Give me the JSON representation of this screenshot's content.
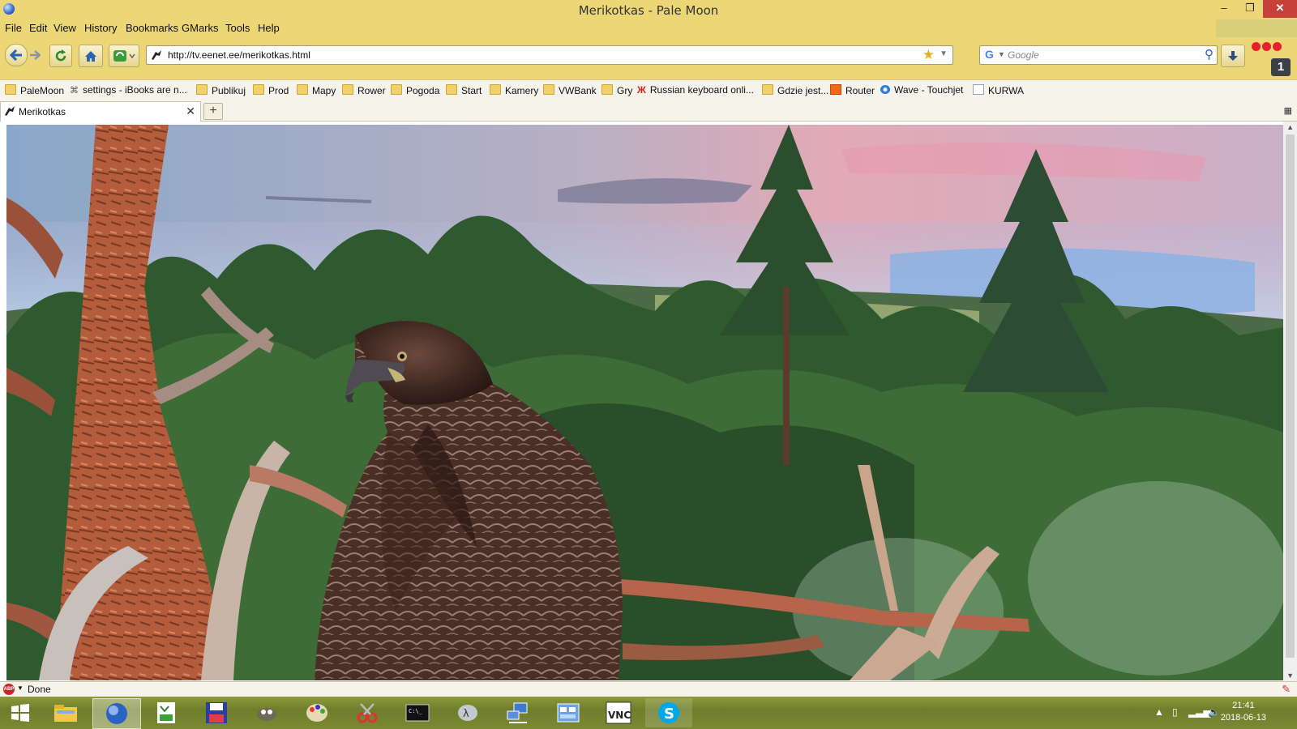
{
  "window": {
    "title": "Merikotkas - Pale Moon",
    "min_glyph": "–",
    "max_glyph": "❐",
    "close_glyph": "✕"
  },
  "menu": [
    "File",
    "Edit",
    "View",
    "History",
    "Bookmarks",
    "GMarks",
    "Tools",
    "Help"
  ],
  "navbar": {
    "url": "http://tv.eenet.ee/merikotkas.html",
    "search_placeholder": "Google",
    "addon_badge": "1"
  },
  "bookmarks": [
    {
      "label": "PaleMoon",
      "icon": "folder"
    },
    {
      "label": "settings - iBooks are n...",
      "icon": "gmarks"
    },
    {
      "label": "Publikuj",
      "icon": "folder"
    },
    {
      "label": "Prod",
      "icon": "folder"
    },
    {
      "label": "Mapy",
      "icon": "folder"
    },
    {
      "label": "Rower",
      "icon": "folder"
    },
    {
      "label": "Pogoda",
      "icon": "folder"
    },
    {
      "label": "Start",
      "icon": "folder"
    },
    {
      "label": "Kamery",
      "icon": "folder"
    },
    {
      "label": "VWBank",
      "icon": "folder"
    },
    {
      "label": "Gry",
      "icon": "folder"
    },
    {
      "label": "Russian keyboard onli...",
      "icon": "russian-ж"
    },
    {
      "label": "Gdzie jest...",
      "icon": "folder"
    },
    {
      "label": "Router",
      "icon": "orange-square"
    },
    {
      "label": "Wave - Touchjet",
      "icon": "blue-circle"
    },
    {
      "label": "KURWA",
      "icon": "page"
    }
  ],
  "tab": {
    "label": "Merikotkas",
    "close_glyph": "✕",
    "new_tab_glyph": "+"
  },
  "status": {
    "text": "Done"
  },
  "taskbar": {
    "apps": [
      "start",
      "file-explorer",
      "pale-moon",
      "spreadsheet",
      "floppy-save",
      "gimp",
      "paint",
      "snipping-tool",
      "command-prompt",
      "alt-app",
      "network",
      "control-panel",
      "vnc",
      "skype"
    ],
    "clock_time": "21:41",
    "clock_date": "2018-06-13",
    "vnc_label": "VNC"
  },
  "colors": {
    "chrome_yellow": "#ecd676",
    "close_red": "#c7413a",
    "taskbar_olive": "#7b8933"
  }
}
